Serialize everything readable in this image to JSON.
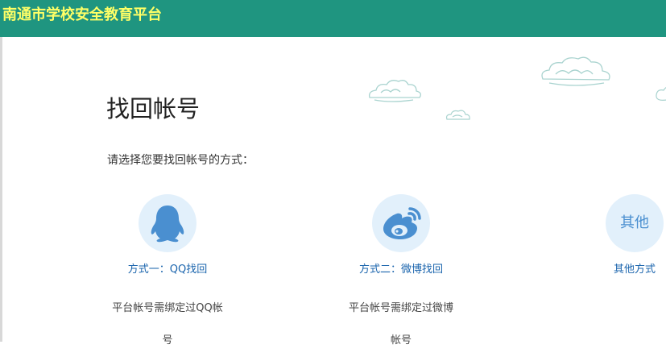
{
  "header": {
    "site_title": "南通市学校安全教育平台",
    "background": "#1f9580",
    "title_color": "#ffff66"
  },
  "main": {
    "title": "找回帐号",
    "prompt": "请选择您要找回帐号的方式：",
    "options": [
      {
        "icon": "qq-penguin-icon",
        "label": "方式一：QQ找回",
        "desc_line1": "平台帐号需绑定过QQ帐",
        "desc_line2": "号"
      },
      {
        "icon": "weibo-icon",
        "label": "方式二：微博找回",
        "desc_line1": "平台帐号需绑定过微博",
        "desc_line2": "帐号"
      },
      {
        "icon": "other-icon",
        "icon_text": "其他",
        "label": "其他方式"
      }
    ]
  },
  "colors": {
    "link": "#1a64ad",
    "icon_bg": "#e2f0fb",
    "icon_fg": "#4a8fd0"
  }
}
